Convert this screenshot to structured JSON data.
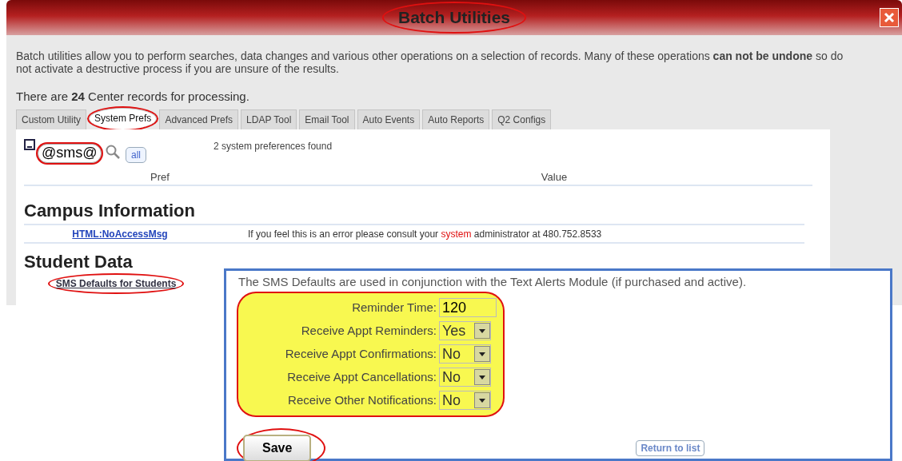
{
  "window": {
    "title": "Batch Utilities",
    "title_circled": true
  },
  "description": "Batch utilities allow you to perform searches, data changes and various other operations on a selection of records. Many of these operations **can not be undone** so do not activate a destructive process if you are unsure of the results.",
  "record_count": "There are **24** Center records for processing.",
  "tabs": [
    {
      "label": "Custom Utility",
      "selected": false,
      "circled": false
    },
    {
      "label": "System Prefs",
      "selected": true,
      "circled": true
    },
    {
      "label": "Advanced Prefs",
      "selected": false,
      "circled": false
    },
    {
      "label": "LDAP Tool",
      "selected": false,
      "circled": false
    },
    {
      "label": "Email Tool",
      "selected": false,
      "circled": false
    },
    {
      "label": "Auto Events",
      "selected": false,
      "circled": false
    },
    {
      "label": "Auto Reports",
      "selected": false,
      "circled": false
    },
    {
      "label": "Q2 Configs",
      "selected": false,
      "circled": false
    }
  ],
  "search": {
    "value": "@sms@",
    "circled": true,
    "all_button": "all",
    "result_count": "2 system preferences found"
  },
  "columns": [
    "Pref",
    "Value"
  ],
  "sections": [
    {
      "heading": "Campus Information",
      "rows": [
        {
          "pref": "HTML:NoAccessMsg",
          "value": [
            {
              "text": "If you feel this is an error please consult your "
            },
            {
              "text": "system",
              "emphasis": true
            },
            {
              "text": " administrator at 480.752.8533"
            }
          ]
        }
      ]
    },
    {
      "heading": "Student Data",
      "rows": [
        {
          "pref": "SMS Defaults for Students",
          "circled": true
        }
      ]
    }
  ],
  "popup": {
    "intro": "The SMS Defaults are used in conjunction with the Text Alerts Module (if purchased and active).",
    "highlighted": true,
    "fields": [
      {
        "kind": "text",
        "label": "Reminder Time:",
        "value": "120"
      },
      {
        "kind": "select",
        "label": "Receive Appt Reminders:",
        "value": "Yes"
      },
      {
        "kind": "select",
        "label": "Receive Appt Confirmations:",
        "value": "No"
      },
      {
        "kind": "select",
        "label": "Receive Appt Cancellations:",
        "value": "No"
      },
      {
        "kind": "select",
        "label": "Receive Other Notifications:",
        "value": "No"
      }
    ],
    "save": {
      "label": "Save",
      "circled": true
    },
    "return_link": "Return to list"
  }
}
